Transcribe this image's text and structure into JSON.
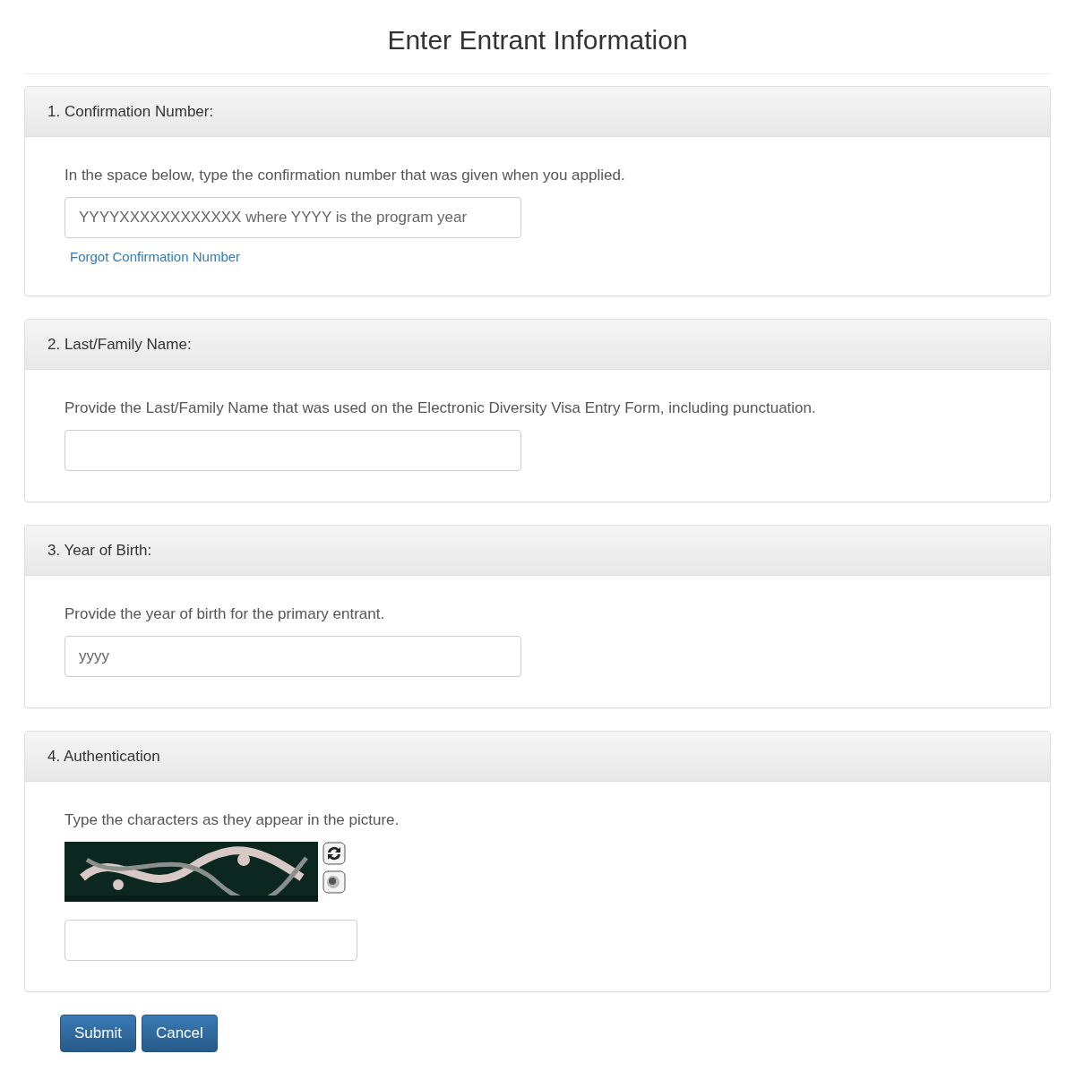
{
  "title": "Enter Entrant Information",
  "sections": [
    {
      "kind": "text",
      "heading": "1. Confirmation Number:",
      "instruction": "In the space below, type the confirmation number that was given when you applied.",
      "placeholder": "YYYYXXXXXXXXXXXX where YYYY is the program year",
      "link": "Forgot Confirmation Number"
    },
    {
      "kind": "text",
      "heading": "2. Last/Family Name:",
      "instruction": "Provide the Last/Family Name that was used on the Electronic Diversity Visa Entry Form, including punctuation."
    },
    {
      "kind": "text",
      "heading": "3. Year of Birth:",
      "instruction": "Provide the year of birth for the primary entrant.",
      "placeholder": "yyyy"
    },
    {
      "kind": "captcha",
      "heading": "4. Authentication",
      "instruction": "Type the characters as they appear in the picture."
    }
  ],
  "buttons": [
    "Submit",
    "Cancel"
  ]
}
